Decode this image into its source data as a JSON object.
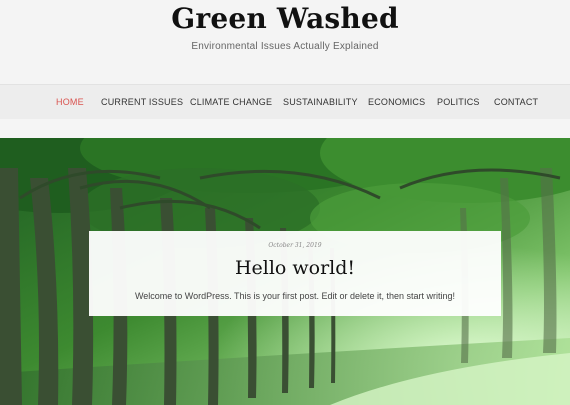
{
  "site": {
    "title": "Green Washed",
    "tagline": "Environmental Issues Actually Explained"
  },
  "nav": {
    "items": [
      {
        "label": "HOME",
        "active": true
      },
      {
        "label": "CURRENT ISSUES"
      },
      {
        "label": "CLIMATE CHANGE"
      },
      {
        "label": "SUSTAINABILITY"
      },
      {
        "label": "ECONOMICS"
      },
      {
        "label": "POLITICS"
      },
      {
        "label": "CONTACT"
      }
    ]
  },
  "post": {
    "date": "October 31, 2019",
    "title": "Hello world!",
    "excerpt": "Welcome to WordPress. This is your first post. Edit or delete it, then start writing!"
  },
  "colors": {
    "accent": "#d9534f",
    "nav_bg": "#ededed",
    "header_bg": "#f4f4f4"
  }
}
